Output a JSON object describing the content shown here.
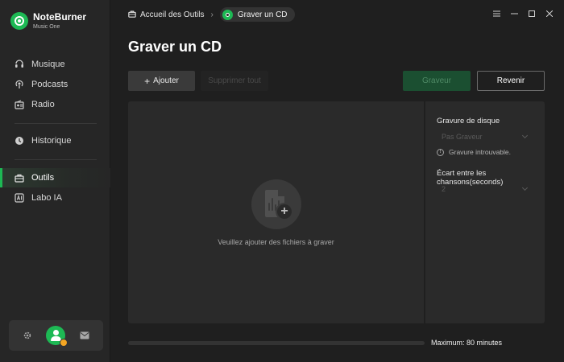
{
  "app": {
    "name": "NoteBurner",
    "subtitle": "Music One"
  },
  "sidebar": {
    "items": [
      {
        "label": "Musique",
        "icon": "music-note-icon",
        "active": false
      },
      {
        "label": "Podcasts",
        "icon": "podcast-icon",
        "active": false
      },
      {
        "label": "Radio",
        "icon": "radio-icon",
        "active": false
      },
      {
        "label": "Historique",
        "icon": "clock-icon",
        "active": false
      },
      {
        "label": "Outils",
        "icon": "toolbox-icon",
        "active": true
      },
      {
        "label": "Labo IA",
        "icon": "ai-lab-icon",
        "active": false
      }
    ],
    "footer": [
      "settings-gear-icon",
      "user-avatar",
      "mail-icon"
    ]
  },
  "breadcrumb": {
    "home": "Accueil des Outils",
    "current": "Graver un CD"
  },
  "page": {
    "title": "Graver un CD"
  },
  "toolbar": {
    "add_label": "Ajouter",
    "remove_label": "Supprimer tout",
    "burn_label": "Graveur",
    "back_label": "Revenir"
  },
  "drop_zone": {
    "hint": "Veuillez ajouter des fichiers à graver"
  },
  "settings": {
    "burner_label": "Gravure de disque",
    "burner_value": "Pas Graveur",
    "burner_warning": "Gravure introuvable.",
    "gap_label": "Écart entre les chansons(seconds)",
    "gap_value": "2"
  },
  "progress": {
    "fraction": 0,
    "label": "Maximum: 80 minutes"
  },
  "colors": {
    "accent": "#1db954",
    "background": "#1f1f1f",
    "sidebar": "#262626",
    "panel": "#2a2a2a"
  }
}
